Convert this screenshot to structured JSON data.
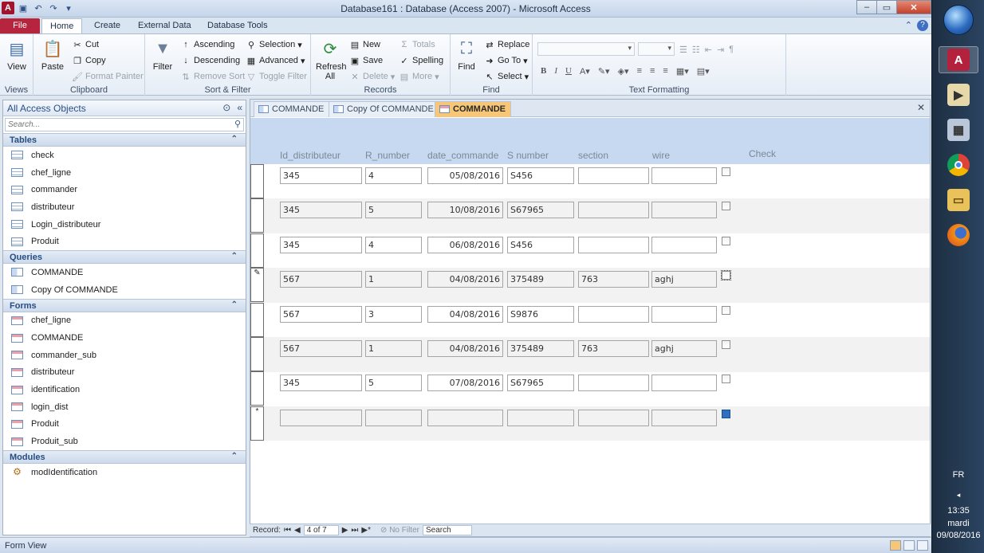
{
  "window": {
    "title": "Database161 : Database (Access 2007) - Microsoft Access",
    "controls": {
      "minimize": "–",
      "maximize": "▭",
      "close": "✕"
    },
    "qat_app_letter": "A"
  },
  "ribbon_tabs": [
    "File",
    "Home",
    "Create",
    "External Data",
    "Database Tools"
  ],
  "ribbon": {
    "views": {
      "view": "View",
      "label": "Views"
    },
    "clipboard": {
      "paste": "Paste",
      "cut": "Cut",
      "copy": "Copy",
      "format_painter": "Format Painter",
      "label": "Clipboard"
    },
    "sort_filter": {
      "filter": "Filter",
      "ascending": "Ascending",
      "descending": "Descending",
      "remove_sort": "Remove Sort",
      "selection": "Selection",
      "advanced": "Advanced",
      "toggle_filter": "Toggle Filter",
      "label": "Sort & Filter"
    },
    "records": {
      "refresh": "Refresh",
      "refresh_sub": "All",
      "new": "New",
      "save": "Save",
      "delete": "Delete",
      "totals": "Totals",
      "spelling": "Spelling",
      "more": "More",
      "label": "Records"
    },
    "find": {
      "find": "Find",
      "replace": "Replace",
      "goto": "Go To",
      "select": "Select",
      "label": "Find"
    },
    "text_formatting": {
      "bold": "B",
      "italic": "I",
      "underline": "U",
      "label": "Text Formatting"
    }
  },
  "nav": {
    "title": "All Access Objects",
    "search_placeholder": "Search...",
    "sections": [
      {
        "name": "Tables",
        "icon": "table-icon",
        "items": [
          "check",
          "chef_ligne",
          "commander",
          "distributeur",
          "Login_distributeur",
          "Produit"
        ]
      },
      {
        "name": "Queries",
        "icon": "query-icon",
        "items": [
          "COMMANDE",
          "Copy Of COMMANDE"
        ]
      },
      {
        "name": "Forms",
        "icon": "form-icon",
        "items": [
          "chef_ligne",
          "COMMANDE",
          "commander_sub",
          "distributeur",
          "identification",
          "login_dist",
          "Produit",
          "Produit_sub"
        ]
      },
      {
        "name": "Modules",
        "icon": "module-icon",
        "items": [
          "modIdentification"
        ]
      }
    ]
  },
  "doc_tabs": [
    {
      "label": "COMMANDE",
      "active": false
    },
    {
      "label": "Copy Of COMMANDE",
      "active": false
    },
    {
      "label": "COMMANDE",
      "active": true
    }
  ],
  "form": {
    "columns": [
      "Id_distributeur",
      "R_number",
      "date_commande",
      "S number",
      "section",
      "wire",
      "Check"
    ],
    "rows": [
      {
        "selector": "",
        "id": "345",
        "r": "4",
        "date": "05/08/2016",
        "s": "S456",
        "section": "",
        "wire": ""
      },
      {
        "selector": "",
        "id": "345",
        "r": "5",
        "date": "10/08/2016",
        "s": "S67965",
        "section": "",
        "wire": ""
      },
      {
        "selector": "",
        "id": "345",
        "r": "4",
        "date": "06/08/2016",
        "s": "S456",
        "section": "",
        "wire": ""
      },
      {
        "selector": "✎",
        "id": "567",
        "r": "1",
        "date": "04/08/2016",
        "s": "375489",
        "section": "763",
        "wire": "aghj"
      },
      {
        "selector": "",
        "id": "567",
        "r": "3",
        "date": "04/08/2016",
        "s": "S9876",
        "section": "",
        "wire": ""
      },
      {
        "selector": "",
        "id": "567",
        "r": "1",
        "date": "04/08/2016",
        "s": "375489",
        "section": "763",
        "wire": "aghj"
      },
      {
        "selector": "",
        "id": "345",
        "r": "5",
        "date": "07/08/2016",
        "s": "S67965",
        "section": "",
        "wire": ""
      },
      {
        "selector": "*",
        "id": "",
        "r": "",
        "date": "",
        "s": "",
        "section": "",
        "wire": ""
      }
    ]
  },
  "record_nav": {
    "label": "Record:",
    "position": "4 of 7",
    "no_filter": "No Filter",
    "search": "Search"
  },
  "status": {
    "text": "Form View"
  },
  "taskbar": {
    "lang": "FR",
    "time": "13:35",
    "day": "mardi",
    "date": "09/08/2016"
  }
}
